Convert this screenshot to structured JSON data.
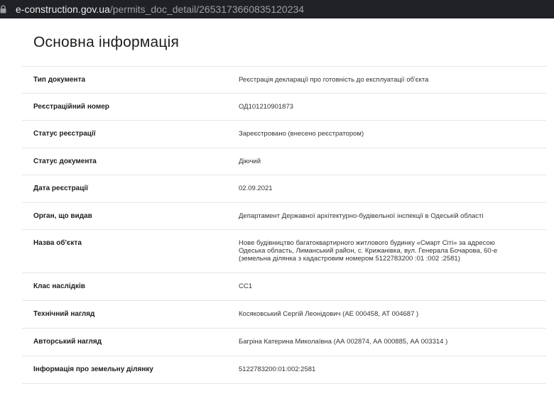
{
  "browser": {
    "url_domain": "e-construction.gov.ua",
    "url_path": "/permits_doc_detail/2653173660835120234"
  },
  "page": {
    "title": "Основна інформація"
  },
  "rows": [
    {
      "label": "Тип документа",
      "value": "Реєстрація декларації про готовність до експлуатації об'єкта"
    },
    {
      "label": "Реєстраційний номер",
      "value": "ОД101210901873"
    },
    {
      "label": "Статус реєстрації",
      "value": "Зареєстровано (внесено реєстратором)"
    },
    {
      "label": "Статус документа",
      "value": "Діючий"
    },
    {
      "label": "Дата реєстрації",
      "value": "02.09.2021"
    },
    {
      "label": "Орган, що видав",
      "value": "Департамент Державної архітектурно-будівельної інспекції в Одеській області"
    },
    {
      "label": "Назва об'єкта",
      "value_lines": [
        "Нове будівництво багатоквартирного житлового будинку «Смарт Сіті» за адресою",
        "Одеська область, Лиманський район, с. Крижанівка, вул. Генерала Бочарова, 60-е",
        "(земельна ділянка з кадастровим номером 5122783200 :01 :002 :2581)"
      ]
    },
    {
      "label": "Клас наслідків",
      "value": "СС1"
    },
    {
      "label": "Технічний нагляд",
      "value": "Косяковський Сергій Леонідович (АЕ 000458, АТ 004687 )"
    },
    {
      "label": "Авторський нагляд",
      "value": "Багріна Катерина Миколаївна (АА 002874, АА 000885, АА 003314 )"
    },
    {
      "label": "Інформація про земельну ділянку",
      "value": "5122783200:01:002:2581"
    }
  ]
}
